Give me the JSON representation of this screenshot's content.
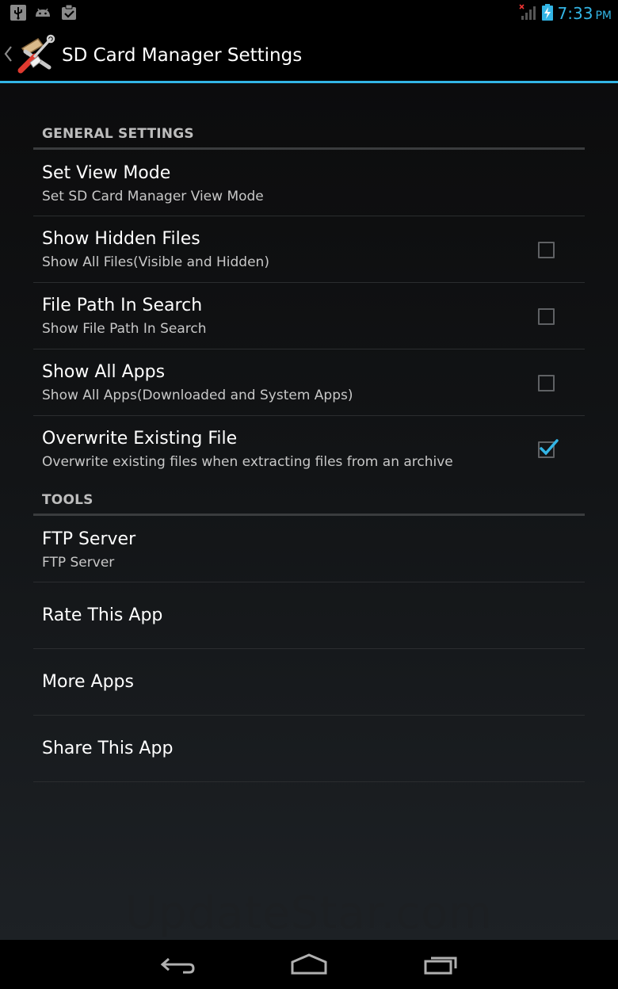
{
  "status_bar": {
    "icons_left": [
      "usb-icon",
      "android-icon",
      "clipboard-icon"
    ],
    "icons_right": [
      "signal-icon",
      "battery-charging-icon"
    ],
    "time": "7:33",
    "ampm": "PM"
  },
  "action_bar": {
    "title": "SD Card Manager Settings",
    "app_icon": "tools-icon",
    "back_icon": "chevron-left-icon"
  },
  "categories": {
    "general": "GENERAL SETTINGS",
    "tools": "TOOLS"
  },
  "general_settings": [
    {
      "title": "Set View Mode",
      "summary": "Set SD Card Manager View Mode",
      "has_checkbox": false
    },
    {
      "title": "Show Hidden Files",
      "summary": "Show All Files(Visible and Hidden)",
      "has_checkbox": true,
      "checked": false
    },
    {
      "title": "File Path In Search",
      "summary": "Show File Path In Search",
      "has_checkbox": true,
      "checked": false
    },
    {
      "title": "Show All Apps",
      "summary": "Show All Apps(Downloaded and System Apps)",
      "has_checkbox": true,
      "checked": false
    },
    {
      "title": "Overwrite Existing File",
      "summary": "Overwrite existing files when extracting files from an archive",
      "has_checkbox": true,
      "checked": true
    }
  ],
  "tools": [
    {
      "title": "FTP Server",
      "summary": "FTP Server"
    },
    {
      "title": "Rate This App"
    },
    {
      "title": "More Apps"
    },
    {
      "title": "Share This App"
    }
  ],
  "watermark": "UpdateStar.com",
  "nav_bar": [
    "back-icon",
    "home-icon",
    "recent-apps-icon"
  ],
  "colors": {
    "accent": "#33b5e5",
    "background": "#000000",
    "checkbox_border": "#5f6164"
  }
}
